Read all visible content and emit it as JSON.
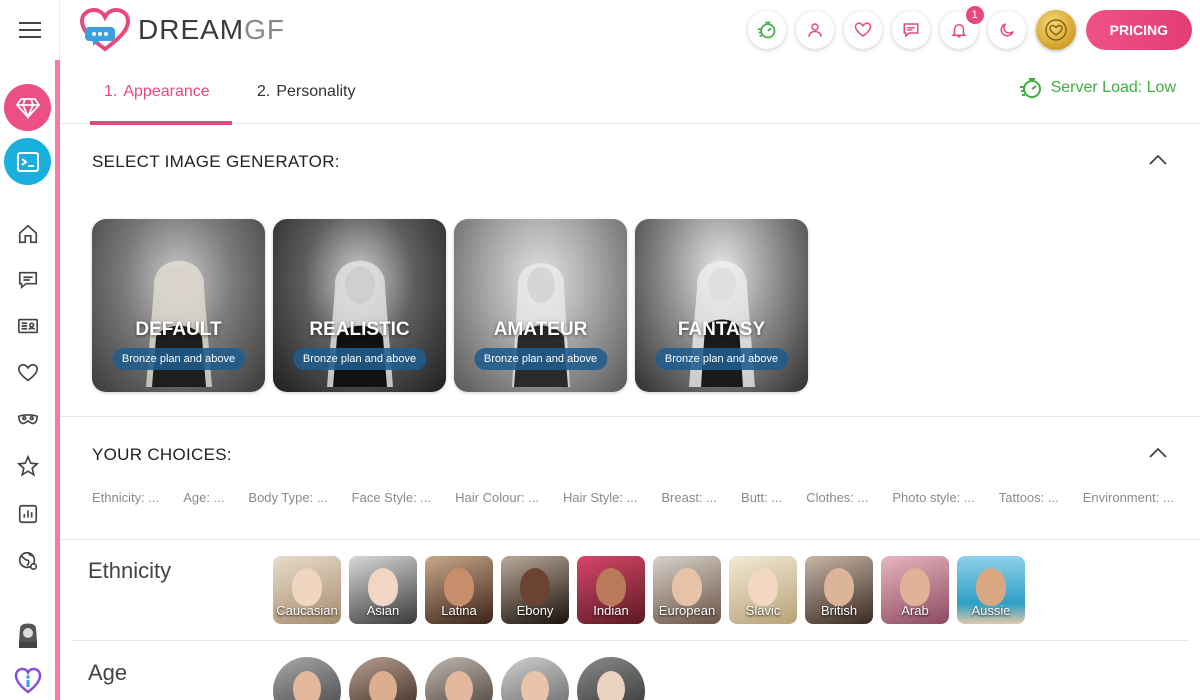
{
  "app": {
    "logo_main": "DREAM",
    "logo_accent": "GF",
    "accent_color": "#e8487a"
  },
  "topbar": {
    "icons": [
      "speed-icon",
      "user-icon",
      "heart-icon",
      "chat-icon",
      "bell-icon",
      "moon-icon",
      "coin-icon"
    ],
    "notification_count": "1",
    "pricing_label": "PRICING"
  },
  "sidebar": {
    "items": [
      "diamond-icon",
      "terminal-icon",
      "home-icon",
      "chat-icon",
      "id-card-icon",
      "heart-icon",
      "mask-icon",
      "star-icon",
      "chart-icon",
      "globe-icon",
      "avatar",
      "info-logo-icon"
    ]
  },
  "tabs": [
    {
      "num": "1.",
      "label": "Appearance",
      "active": true
    },
    {
      "num": "2.",
      "label": "Personality",
      "active": false
    }
  ],
  "server_load": "Server Load: Low",
  "generator_section": {
    "title": "SELECT IMAGE GENERATOR:",
    "cards": [
      {
        "name": "DEFAULT",
        "badge": "Bronze plan and above"
      },
      {
        "name": "REALISTIC",
        "badge": "Bronze plan and above"
      },
      {
        "name": "AMATEUR",
        "badge": "Bronze plan and above"
      },
      {
        "name": "FANTASY",
        "badge": "Bronze plan and above"
      }
    ]
  },
  "choices_section": {
    "title": "YOUR CHOICES:",
    "items": [
      "Ethnicity: ...",
      "Age: ...",
      "Body Type: ...",
      "Face Style: ...",
      "Hair Colour: ...",
      "Hair Style: ...",
      "Breast: ...",
      "Butt: ...",
      "Clothes: ...",
      "Photo style: ...",
      "Tattoos: ...",
      "Environment: ..."
    ]
  },
  "ethnicity": {
    "label": "Ethnicity",
    "options": [
      "Caucasian",
      "Asian",
      "Latina",
      "Ebony",
      "Indian",
      "European",
      "Slavic",
      "British",
      "Arab",
      "Aussie"
    ]
  },
  "age": {
    "label": "Age"
  }
}
